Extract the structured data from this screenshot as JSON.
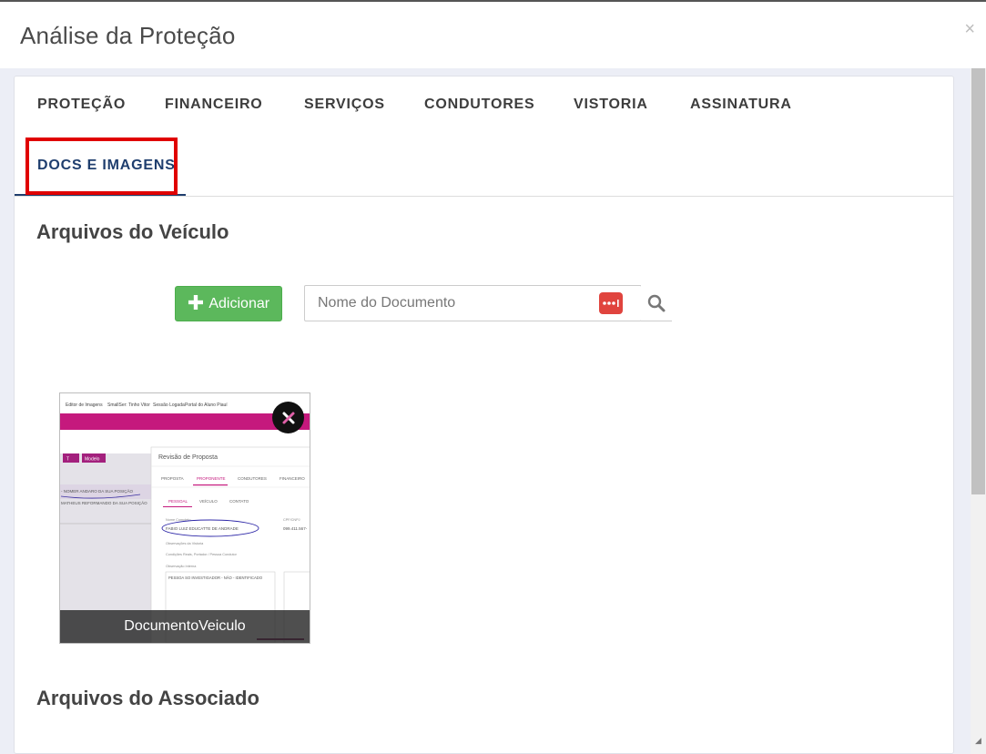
{
  "modal": {
    "title": "Análise da Proteção",
    "close_label": "×"
  },
  "tabs": [
    {
      "label": "PROTEÇÃO",
      "active": false
    },
    {
      "label": "FINANCEIRO",
      "active": false
    },
    {
      "label": "SERVIÇOS",
      "active": false
    },
    {
      "label": "CONDUTORES",
      "active": false
    },
    {
      "label": "VISTORIA",
      "active": false
    },
    {
      "label": "ASSINATURA",
      "active": false
    },
    {
      "label": "DOCS E IMAGENS",
      "active": true
    }
  ],
  "vehicle_files": {
    "title": "Arquivos do Veículo",
    "add_button_label": "Adicionar",
    "search_placeholder": "Nome do Documento",
    "search_value": "",
    "documents": [
      {
        "caption": "DocumentoVeiculo",
        "preview": {
          "browser_tabs": [
            "Editor de Imagens",
            "SmallSer: Tinho Vitor",
            "Sessão Logada",
            "Portal do Aluno Piauí"
          ],
          "dialog_title": "Revisão de Proposta",
          "dialog_tabs": [
            "PROPOSTA",
            "PROPONENTE",
            "CONDUTORES",
            "FINANCEIRO"
          ],
          "dialog_subtabs": [
            "PESSOAL",
            "VEÍCULO",
            "CONTATO"
          ],
          "left_buttons": [
            "T",
            "Modelo"
          ],
          "left_rows": [
            "- NOMER ANDARO DA SUA POSIÇÃO",
            "MATHEUS REFORMANDO DA SUA POSIÇÃO"
          ],
          "fields": [
            {
              "label": "Nome Completo",
              "value": "FABIO LUIZ EDUCATTE DE ANDRADE"
            },
            {
              "label": "CPF/CNPJ",
              "value": "099.411.567-"
            },
            {
              "label": "Observações da Vistoria",
              "value": ""
            },
            {
              "label": "Condições Reais, Portador / Pessoa Condutor",
              "value": ""
            },
            {
              "label": "Observação Interna",
              "value": "PESSOA SO INVESTIGADOR - NÃO - IDENTIFICADO"
            }
          ]
        }
      }
    ]
  },
  "associate_files": {
    "title": "Arquivos do Associado"
  },
  "colors": {
    "accent": "#1f3e6e",
    "highlight": "#e00000",
    "add_button": "#5cb85c",
    "password_manager_icon": "#e0443e",
    "preview_banner": "#c5197d"
  },
  "icons": {
    "close": "close-icon",
    "add": "plus-icon",
    "password_manager": "password-manager-icon",
    "search": "search-icon",
    "delete": "delete-icon"
  }
}
